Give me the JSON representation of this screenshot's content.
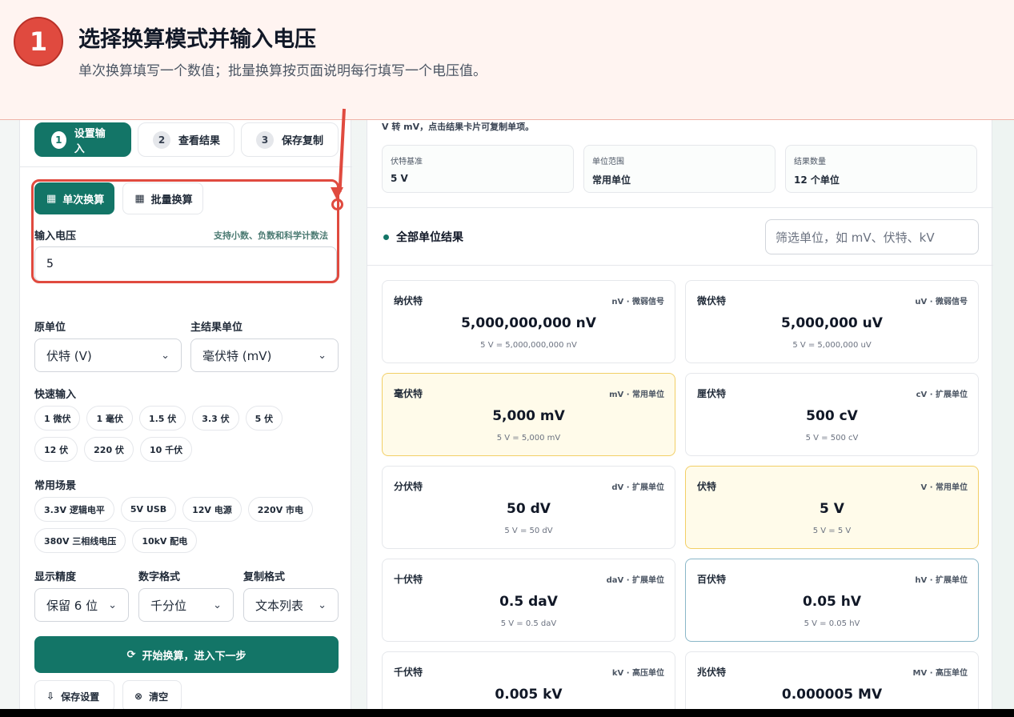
{
  "banner": {
    "step_number": "1",
    "title": "选择换算模式并输入电压",
    "subtitle": "单次换算填写一个数值；批量换算按页面说明每行填写一个电压值。"
  },
  "steps": [
    {
      "num": "1",
      "label": "设置输入"
    },
    {
      "num": "2",
      "label": "查看结果"
    },
    {
      "num": "3",
      "label": "保存复制"
    }
  ],
  "mode_tabs": {
    "single": "单次换算",
    "batch": "批量换算"
  },
  "input": {
    "label": "输入电压",
    "hint": "支持小数、负数和科学计数法",
    "value": "5"
  },
  "source_unit": {
    "label": "原单位",
    "value": "伏特 (V)"
  },
  "result_unit": {
    "label": "主结果单位",
    "value": "毫伏特 (mV)"
  },
  "quick_input": {
    "label": "快速输入",
    "items": [
      "1 微伏",
      "1 毫伏",
      "1.5 伏",
      "3.3 伏",
      "5 伏",
      "12 伏",
      "220 伏",
      "10 千伏"
    ]
  },
  "scenes": {
    "label": "常用场景",
    "items": [
      "3.3V 逻辑电平",
      "5V USB",
      "12V 电源",
      "220V 市电",
      "380V 三相线电压",
      "10kV 配电"
    ]
  },
  "precision": {
    "label": "显示精度",
    "value": "保留 6 位"
  },
  "number_format": {
    "label": "数字格式",
    "value": "千分位"
  },
  "copy_format": {
    "label": "复制格式",
    "value": "文本列表"
  },
  "actions": {
    "start": "开始换算，进入下一步",
    "save": "保存设置",
    "clear": "清空"
  },
  "right": {
    "note": "V 转 mV，点击结果卡片可复制单项。",
    "stats": [
      {
        "key": "伏特基准",
        "value": "5 V"
      },
      {
        "key": "单位范围",
        "value": "常用单位"
      },
      {
        "key": "结果数量",
        "value": "12 个单位"
      }
    ],
    "section_title": "全部单位结果",
    "filter_placeholder": "筛选单位，如 mV、伏特、kV"
  },
  "results": [
    {
      "name": "纳伏特",
      "tag": "nV · 微弱信号",
      "value": "5,000,000,000 nV",
      "eq": "5 V = 5,000,000,000 nV",
      "style": ""
    },
    {
      "name": "微伏特",
      "tag": "uV · 微弱信号",
      "value": "5,000,000 uV",
      "eq": "5 V = 5,000,000 uV",
      "style": ""
    },
    {
      "name": "毫伏特",
      "tag": "mV · 常用单位",
      "value": "5,000 mV",
      "eq": "5 V = 5,000 mV",
      "style": "hl"
    },
    {
      "name": "厘伏特",
      "tag": "cV · 扩展单位",
      "value": "500 cV",
      "eq": "5 V = 500 cV",
      "style": ""
    },
    {
      "name": "分伏特",
      "tag": "dV · 扩展单位",
      "value": "50 dV",
      "eq": "5 V = 50 dV",
      "style": ""
    },
    {
      "name": "伏特",
      "tag": "V · 常用单位",
      "value": "5 V",
      "eq": "5 V = 5 V",
      "style": "hl"
    },
    {
      "name": "十伏特",
      "tag": "daV · 扩展单位",
      "value": "0.5 daV",
      "eq": "5 V = 0.5 daV",
      "style": ""
    },
    {
      "name": "百伏特",
      "tag": "hV · 扩展单位",
      "value": "0.05 hV",
      "eq": "5 V = 0.05 hV",
      "style": "focus"
    },
    {
      "name": "千伏特",
      "tag": "kV · 高压单位",
      "value": "0.005 kV",
      "eq": "",
      "style": ""
    },
    {
      "name": "兆伏特",
      "tag": "MV · 高压单位",
      "value": "0.000005 MV",
      "eq": "",
      "style": ""
    }
  ]
}
